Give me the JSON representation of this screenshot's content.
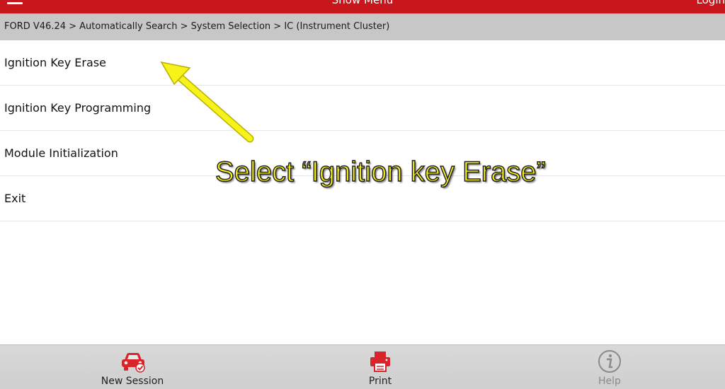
{
  "header": {
    "title": "Show Menu",
    "right_label": "Login"
  },
  "breadcrumb": "FORD V46.24 > Automatically Search > System Selection > IC (Instrument Cluster)",
  "menu_items": [
    {
      "label": "Ignition Key Erase"
    },
    {
      "label": "Ignition Key Programming"
    },
    {
      "label": "Module Initialization"
    },
    {
      "label": "Exit"
    }
  ],
  "annotation": {
    "caption": "Select “Ignition key Erase”",
    "color": "#f7f21a"
  },
  "bottom_bar": {
    "buttons": [
      {
        "label": "New Session",
        "icon": "car-check-icon"
      },
      {
        "label": "Print",
        "icon": "printer-icon"
      },
      {
        "label": "Help",
        "icon": "info-icon",
        "state": "disabled"
      }
    ]
  },
  "colors": {
    "brand_red": "#c8161d",
    "breadcrumb_bg": "#c7c7c7",
    "toolbar_bg": "#d3d3d3"
  }
}
